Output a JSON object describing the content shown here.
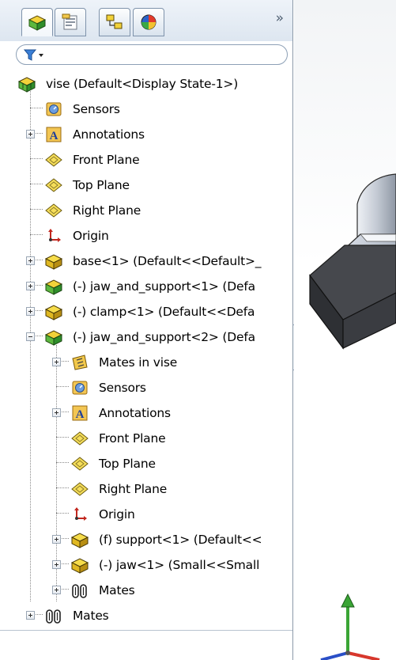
{
  "feature_tree": {
    "tabs": [
      {
        "name": "FeatureManager design tree",
        "icon": "feature-tree-icon"
      },
      {
        "name": "PropertyManager",
        "icon": "property-manager-icon"
      },
      {
        "name": "ConfigurationManager",
        "icon": "configuration-manager-icon"
      },
      {
        "name": "DisplayManager",
        "icon": "display-manager-icon"
      }
    ],
    "expand_glyph": "»",
    "filter_icon": "filter-icon",
    "items": [
      {
        "label": "vise  (Default<Display State-1>)",
        "icon": "assembly-icon"
      },
      {
        "label": "Sensors",
        "icon": "sensors-icon"
      },
      {
        "label": "Annotations",
        "icon": "annotations-icon"
      },
      {
        "label": "Front Plane",
        "icon": "plane-icon"
      },
      {
        "label": "Top Plane",
        "icon": "plane-icon"
      },
      {
        "label": "Right Plane",
        "icon": "plane-icon"
      },
      {
        "label": "Origin",
        "icon": "origin-icon"
      },
      {
        "label": "base<1> (Default<<Default>_",
        "icon": "part-icon"
      },
      {
        "label": "(-) jaw_and_support<1> (Defa",
        "icon": "subassembly-icon"
      },
      {
        "label": "(-) clamp<1> (Default<<Defa",
        "icon": "part-icon"
      },
      {
        "label": "(-) jaw_and_support<2> (Defa",
        "icon": "subassembly-icon"
      },
      {
        "label": "Mates in vise",
        "icon": "mates-folder-icon"
      },
      {
        "label": "Sensors",
        "icon": "sensors-icon"
      },
      {
        "label": "Annotations",
        "icon": "annotations-icon"
      },
      {
        "label": "Front Plane",
        "icon": "plane-icon"
      },
      {
        "label": "Top Plane",
        "icon": "plane-icon"
      },
      {
        "label": "Right Plane",
        "icon": "plane-icon"
      },
      {
        "label": "Origin",
        "icon": "origin-icon"
      },
      {
        "label": "(f) support<1> (Default<<",
        "icon": "part-icon"
      },
      {
        "label": "(-) jaw<1> (Small<<Small",
        "icon": "part-icon"
      },
      {
        "label": "Mates",
        "icon": "mates-icon"
      },
      {
        "label": "Mates",
        "icon": "mates-icon"
      }
    ]
  },
  "viewport": {
    "model": "3d-model-view",
    "triad": "reference-triad-icon"
  },
  "colors": {
    "panel_bg": "#ffffff",
    "tab_border": "#7f93ab",
    "part_yellow": "#e8c51e",
    "assembly_green": "#3ea33b",
    "model_gray": "#9aa3b0"
  }
}
